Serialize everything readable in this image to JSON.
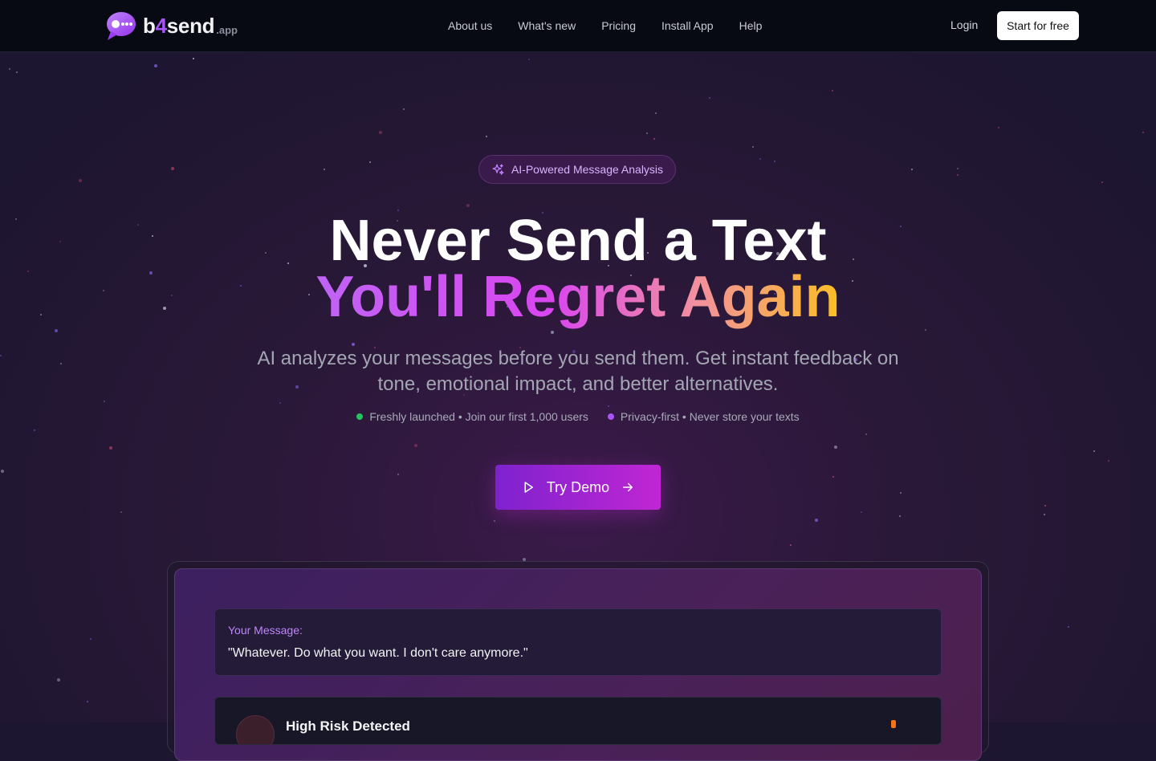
{
  "brand": {
    "name_b": "b",
    "name_four": "4",
    "name_send": "send",
    "suffix": ".app",
    "accent": "#a855f7"
  },
  "nav": {
    "links": [
      "About us",
      "What's new",
      "Pricing",
      "Install App",
      "Help"
    ],
    "login": "Login",
    "cta": "Start for free"
  },
  "hero": {
    "badge": {
      "icon": "sparkles-icon",
      "text": "AI-Powered Message Analysis"
    },
    "title_line1": "Never Send a Text",
    "title_line2": "You'll Regret Again",
    "subtitle": "AI analyzes your messages before you send them. Get instant feedback on tone, emotional impact, and better alternatives.",
    "facts": [
      {
        "text": "Freshly launched • Join our first 1,000 users",
        "dot_color": "#22c55e"
      },
      {
        "text": "Privacy-first • Never store your texts",
        "dot_color": "#a855f7"
      }
    ],
    "demo_button": {
      "label": "Try Demo",
      "left_icon": "play-icon",
      "right_icon": "arrow-right-icon"
    }
  },
  "demo": {
    "message_label": "Your Message:",
    "message_text": "\"Whatever. Do what you want. I don't care anymore.\"",
    "result_title": "High Risk Detected"
  }
}
